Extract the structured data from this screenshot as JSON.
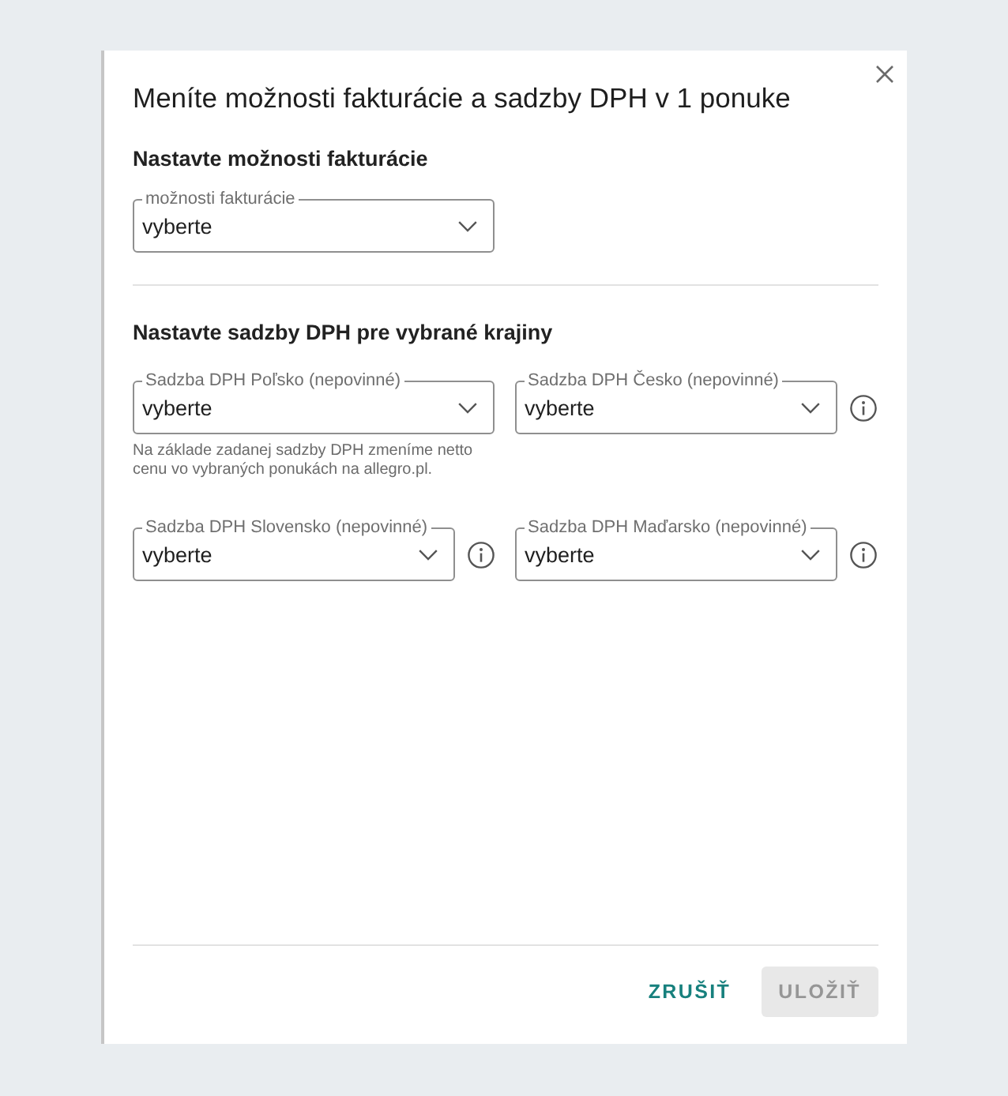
{
  "dialog": {
    "title": "Meníte možnosti fakturácie a sadzby DPH v 1 ponuke"
  },
  "sections": [
    {
      "heading": "Nastavte možnosti fakturácie",
      "fields": [
        {
          "label": "možnosti fakturácie",
          "value": "vyberte",
          "info": false
        }
      ]
    },
    {
      "heading": "Nastavte sadzby DPH pre vybrané krajiny",
      "fields": [
        {
          "label": "Sadzba DPH Poľsko (nepovinné)",
          "value": "vyberte",
          "info": false,
          "hint": "Na základe zadanej sadzby DPH zmeníme netto cenu vo vybraných ponukách na allegro.pl."
        },
        {
          "label": "Sadzba DPH Česko (nepovinné)",
          "value": "vyberte",
          "info": true
        },
        {
          "label": "Sadzba DPH Slovensko (nepovinné)",
          "value": "vyberte",
          "info": true
        },
        {
          "label": "Sadzba DPH Maďarsko (nepovinné)",
          "value": "vyberte",
          "info": true
        }
      ]
    }
  ],
  "footer": {
    "buttons": [
      {
        "label": "ZRUŠIŤ",
        "kind": "text",
        "disabled": false
      },
      {
        "label": "ULOŽIŤ",
        "kind": "filled",
        "disabled": true
      }
    ]
  }
}
